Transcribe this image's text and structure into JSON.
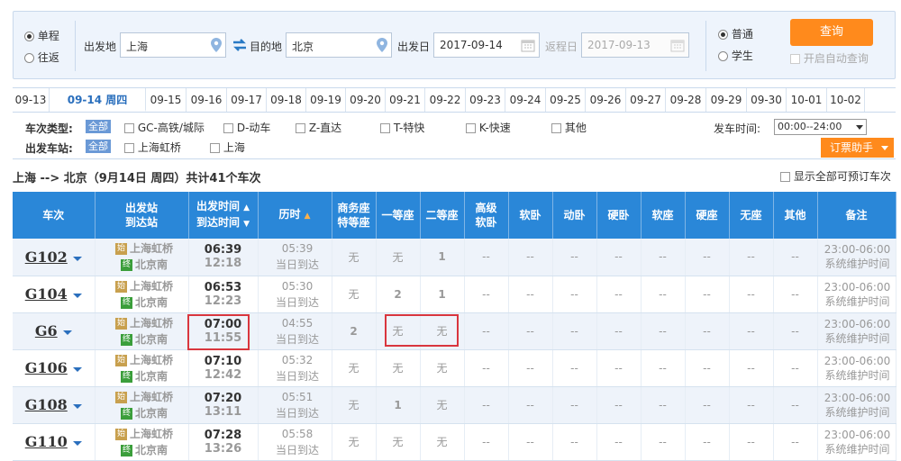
{
  "search": {
    "trip_one_way": "单程",
    "trip_round": "往返",
    "from_label": "出发地",
    "from_value": "上海",
    "to_label": "目的地",
    "to_value": "北京",
    "date_label": "出发日",
    "date_value": "2017-09-14",
    "return_label": "返程日",
    "return_value": "2017-09-13",
    "type_normal": "普通",
    "type_student": "学生",
    "query_label": "查询",
    "auto_query_label": "开启自动查询"
  },
  "date_tabs": [
    "09-13",
    "09-14  周四",
    "09-15",
    "09-16",
    "09-17",
    "09-18",
    "09-19",
    "09-20",
    "09-21",
    "09-22",
    "09-23",
    "09-24",
    "09-25",
    "09-26",
    "09-27",
    "09-28",
    "09-29",
    "09-30",
    "10-01",
    "10-02"
  ],
  "filter": {
    "train_type_label": "车次类型:",
    "all_tag": "全部",
    "types": [
      "GC-高铁/城际",
      "D-动车",
      "Z-直达",
      "T-特快",
      "K-快速",
      "其他"
    ],
    "station_label": "出发车站:",
    "stations": [
      "上海虹桥",
      "上海"
    ],
    "depart_time_label": "发车时间:",
    "depart_time_value": "00:00--24:00",
    "helper_label": "订票助手"
  },
  "route_summary": "上海 --> 北京（9月14日  周四）共计41个车次",
  "show_all_label": "显示全部可预订车次",
  "table": {
    "headers": {
      "train": "车次",
      "station_top": "出发站",
      "station_bottom": "到达站",
      "time_top": "出发时间",
      "time_bottom": "到达时间",
      "duration": "历时",
      "business_top": "商务座",
      "business_bottom": "特等座",
      "first": "一等座",
      "second": "二等座",
      "adv_top": "高级",
      "adv_bottom": "软卧",
      "soft_sleeper": "软卧",
      "moving_sleeper": "动卧",
      "hard_sleeper": "硬卧",
      "soft_seat": "软座",
      "hard_seat": "硬座",
      "no_seat": "无座",
      "other": "其他",
      "remark": "备注"
    },
    "rows": [
      {
        "train": "G102",
        "from": "上海虹桥",
        "to": "北京南",
        "dep": "06:39",
        "arr": "12:18",
        "dur": "05:39",
        "day": "当日到达",
        "business": "无",
        "first": "无",
        "second": "1",
        "note": "23:00-06:00系统维护时间"
      },
      {
        "train": "G104",
        "from": "上海虹桥",
        "to": "北京南",
        "dep": "06:53",
        "arr": "12:23",
        "dur": "05:30",
        "day": "当日到达",
        "business": "无",
        "first": "2",
        "second": "1",
        "note": "23:00-06:00系统维护时间"
      },
      {
        "train": "G6",
        "from": "上海虹桥",
        "to": "北京南",
        "dep": "07:00",
        "arr": "11:55",
        "dur": "04:55",
        "day": "当日到达",
        "business": "2",
        "first": "无",
        "second": "无",
        "note": "23:00-06:00系统维护时间"
      },
      {
        "train": "G106",
        "from": "上海虹桥",
        "to": "北京南",
        "dep": "07:10",
        "arr": "12:42",
        "dur": "05:32",
        "day": "当日到达",
        "business": "无",
        "first": "无",
        "second": "无",
        "note": "23:00-06:00系统维护时间"
      },
      {
        "train": "G108",
        "from": "上海虹桥",
        "to": "北京南",
        "dep": "07:20",
        "arr": "13:11",
        "dur": "05:51",
        "day": "当日到达",
        "business": "无",
        "first": "1",
        "second": "无",
        "note": "23:00-06:00系统维护时间"
      },
      {
        "train": "G110",
        "from": "上海虹桥",
        "to": "北京南",
        "dep": "07:28",
        "arr": "13:26",
        "dur": "05:58",
        "day": "当日到达",
        "business": "无",
        "first": "无",
        "second": "无",
        "note": "23:00-06:00系统维护时间"
      }
    ],
    "dash": "--",
    "start_badge": "始",
    "end_badge": "终"
  }
}
